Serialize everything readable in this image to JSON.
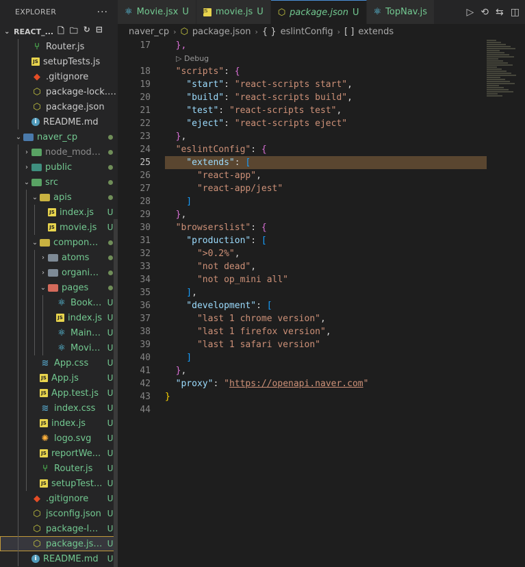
{
  "sidebar": {
    "header": "EXPLORER",
    "more": "···",
    "root": "REACT_...",
    "items": [
      {
        "label": "Router.js",
        "icon": "router-icon",
        "indent": 1,
        "status": "",
        "color": "normal"
      },
      {
        "label": "setupTests.js",
        "icon": "js-icon",
        "indent": 1,
        "status": "",
        "color": "normal"
      },
      {
        "label": ".gitignore",
        "icon": "git-icon",
        "indent": 1,
        "status": "",
        "color": "normal"
      },
      {
        "label": "package-lock.json",
        "icon": "json-icon",
        "indent": 1,
        "status": "",
        "color": "normal"
      },
      {
        "label": "package.json",
        "icon": "json-icon",
        "indent": 1,
        "status": "",
        "color": "normal"
      },
      {
        "label": "README.md",
        "icon": "info-icon",
        "indent": 1,
        "status": "",
        "color": "normal"
      },
      {
        "label": "naver_cp",
        "icon": "folder-blue",
        "indent": 0,
        "twist": "down",
        "status": "dot",
        "color": "mod"
      },
      {
        "label": "node_modules",
        "icon": "folder-green",
        "indent": 1,
        "twist": "right",
        "status": "dot",
        "color": "dim"
      },
      {
        "label": "public",
        "icon": "folder-teal",
        "indent": 1,
        "twist": "right",
        "status": "dot",
        "color": "mod"
      },
      {
        "label": "src",
        "icon": "folder-green",
        "indent": 1,
        "twist": "down",
        "status": "dot",
        "color": "mod"
      },
      {
        "label": "apis",
        "icon": "folder-orange",
        "indent": 2,
        "twist": "down",
        "status": "dot",
        "color": "mod"
      },
      {
        "label": "index.js",
        "icon": "js-icon",
        "indent": 3,
        "status": "U",
        "color": "mod"
      },
      {
        "label": "movie.js",
        "icon": "js-icon",
        "indent": 3,
        "status": "U",
        "color": "mod"
      },
      {
        "label": "compone...",
        "icon": "folder-orange",
        "indent": 2,
        "twist": "down",
        "status": "dot",
        "color": "mod"
      },
      {
        "label": "atoms",
        "icon": "folder-gray",
        "indent": 3,
        "twist": "right",
        "status": "dot",
        "color": "mod"
      },
      {
        "label": "organis...",
        "icon": "folder-gray",
        "indent": 3,
        "twist": "right",
        "status": "dot",
        "color": "mod"
      },
      {
        "label": "pages",
        "icon": "folder-red",
        "indent": 3,
        "twist": "down",
        "status": "dot",
        "color": "mod"
      },
      {
        "label": "Book.jsx",
        "icon": "react-icon",
        "indent": 4,
        "status": "U",
        "color": "mod"
      },
      {
        "label": "index.js",
        "icon": "js-icon",
        "indent": 4,
        "status": "U",
        "color": "mod"
      },
      {
        "label": "Main.jsx",
        "icon": "react-icon",
        "indent": 4,
        "status": "U",
        "color": "mod"
      },
      {
        "label": "Movie.j...",
        "icon": "react-icon",
        "indent": 4,
        "status": "U",
        "color": "mod"
      },
      {
        "label": "App.css",
        "icon": "css-icon",
        "indent": 2,
        "status": "U",
        "color": "mod"
      },
      {
        "label": "App.js",
        "icon": "js-icon",
        "indent": 2,
        "status": "U",
        "color": "mod"
      },
      {
        "label": "App.test.js",
        "icon": "js-icon",
        "indent": 2,
        "status": "U",
        "color": "mod"
      },
      {
        "label": "index.css",
        "icon": "css-icon",
        "indent": 2,
        "status": "U",
        "color": "mod"
      },
      {
        "label": "index.js",
        "icon": "js-icon",
        "indent": 2,
        "status": "U",
        "color": "mod"
      },
      {
        "label": "logo.svg",
        "icon": "svg-icon",
        "indent": 2,
        "status": "U",
        "color": "mod"
      },
      {
        "label": "reportWe...",
        "icon": "js-icon",
        "indent": 2,
        "status": "U",
        "color": "mod"
      },
      {
        "label": "Router.js",
        "icon": "router-icon",
        "indent": 2,
        "status": "U",
        "color": "mod"
      },
      {
        "label": "setupTest...",
        "icon": "js-icon",
        "indent": 2,
        "status": "U",
        "color": "mod"
      },
      {
        "label": ".gitignore",
        "icon": "git-icon",
        "indent": 1,
        "status": "U",
        "color": "mod"
      },
      {
        "label": "jsconfig.json",
        "icon": "json-icon",
        "indent": 1,
        "status": "U",
        "color": "mod"
      },
      {
        "label": "package-lo...",
        "icon": "json-icon",
        "indent": 1,
        "status": "U",
        "color": "mod"
      },
      {
        "label": "package.json",
        "icon": "json-icon",
        "indent": 1,
        "status": "U",
        "color": "mod",
        "selected": true
      },
      {
        "label": "README.md",
        "icon": "info-icon",
        "indent": 1,
        "status": "U",
        "color": "mod"
      }
    ]
  },
  "tabs": [
    {
      "label": "Movie.jsx",
      "badge": "U",
      "icon": "react-icon",
      "active": false
    },
    {
      "label": "movie.js",
      "badge": "U",
      "icon": "js-icon",
      "active": false
    },
    {
      "label": "package.json",
      "badge": "U",
      "icon": "json-icon",
      "active": true
    },
    {
      "label": "TopNav.js",
      "badge": "",
      "icon": "react-icon",
      "active": false
    }
  ],
  "breadcrumb": {
    "folder": "naver_cp",
    "file": "package.json",
    "object": "eslintConfig",
    "array": "extends",
    "object_glyph": "{ }",
    "array_glyph": "[ ]"
  },
  "editor": {
    "current_line": 25,
    "codelens": "Debug",
    "lines": [
      {
        "n": 17,
        "t": [
          [
            "b2",
            "  },"
          ]
        ]
      },
      {
        "n": 18,
        "t": [
          [
            "kkey2",
            "  \"scripts\""
          ],
          [
            "p",
            ": "
          ],
          [
            "b2",
            "{"
          ]
        ]
      },
      {
        "n": 19,
        "t": [
          [
            "kkey",
            "    \"start\""
          ],
          [
            "p",
            ": "
          ],
          [
            "s",
            "\"react-scripts start\""
          ],
          [
            "p",
            ","
          ]
        ]
      },
      {
        "n": 20,
        "t": [
          [
            "kkey",
            "    \"build\""
          ],
          [
            "p",
            ": "
          ],
          [
            "s",
            "\"react-scripts build\""
          ],
          [
            "p",
            ","
          ]
        ]
      },
      {
        "n": 21,
        "t": [
          [
            "kkey",
            "    \"test\""
          ],
          [
            "p",
            ": "
          ],
          [
            "s",
            "\"react-scripts test\""
          ],
          [
            "p",
            ","
          ]
        ]
      },
      {
        "n": 22,
        "t": [
          [
            "kkey",
            "    \"eject\""
          ],
          [
            "p",
            ": "
          ],
          [
            "s",
            "\"react-scripts eject\""
          ]
        ]
      },
      {
        "n": 23,
        "t": [
          [
            "b2",
            "  }"
          ],
          [
            "p",
            ","
          ]
        ]
      },
      {
        "n": 24,
        "t": [
          [
            "kkey2",
            "  \"eslintConfig\""
          ],
          [
            "p",
            ": "
          ],
          [
            "b2",
            "{"
          ]
        ]
      },
      {
        "n": 25,
        "t": [
          [
            "kkey",
            "    \"extends\""
          ],
          [
            "p",
            ": "
          ],
          [
            "b3",
            "["
          ]
        ]
      },
      {
        "n": 26,
        "t": [
          [
            "s",
            "      \"react-app\""
          ],
          [
            "p",
            ","
          ]
        ]
      },
      {
        "n": 27,
        "t": [
          [
            "s",
            "      \"react-app/jest\""
          ]
        ]
      },
      {
        "n": 28,
        "t": [
          [
            "b3",
            "    ]"
          ]
        ]
      },
      {
        "n": 29,
        "t": [
          [
            "b2",
            "  }"
          ],
          [
            "p",
            ","
          ]
        ]
      },
      {
        "n": 30,
        "t": [
          [
            "kkey2",
            "  \"browserslist\""
          ],
          [
            "p",
            ": "
          ],
          [
            "b2",
            "{"
          ]
        ]
      },
      {
        "n": 31,
        "t": [
          [
            "kkey",
            "    \"production\""
          ],
          [
            "p",
            ": "
          ],
          [
            "b3",
            "["
          ]
        ]
      },
      {
        "n": 32,
        "t": [
          [
            "s",
            "      \">0.2%\""
          ],
          [
            "p",
            ","
          ]
        ]
      },
      {
        "n": 33,
        "t": [
          [
            "s",
            "      \"not dead\""
          ],
          [
            "p",
            ","
          ]
        ]
      },
      {
        "n": 34,
        "t": [
          [
            "s",
            "      \"not op_mini all\""
          ]
        ]
      },
      {
        "n": 35,
        "t": [
          [
            "b3",
            "    ]"
          ],
          [
            "p",
            ","
          ]
        ]
      },
      {
        "n": 36,
        "t": [
          [
            "kkey",
            "    \"development\""
          ],
          [
            "p",
            ": "
          ],
          [
            "b3",
            "["
          ]
        ]
      },
      {
        "n": 37,
        "t": [
          [
            "s",
            "      \"last 1 chrome version\""
          ],
          [
            "p",
            ","
          ]
        ]
      },
      {
        "n": 38,
        "t": [
          [
            "s",
            "      \"last 1 firefox version\""
          ],
          [
            "p",
            ","
          ]
        ]
      },
      {
        "n": 39,
        "t": [
          [
            "s",
            "      \"last 1 safari version\""
          ]
        ]
      },
      {
        "n": 40,
        "t": [
          [
            "b3",
            "    ]"
          ]
        ]
      },
      {
        "n": 41,
        "t": [
          [
            "b2",
            "  }"
          ],
          [
            "p",
            ","
          ]
        ]
      },
      {
        "n": 42,
        "t": [
          [
            "kkey",
            "  \"proxy\""
          ],
          [
            "p",
            ": "
          ],
          [
            "s",
            "\""
          ],
          [
            "su",
            "https://openapi.naver.com"
          ],
          [
            "s",
            "\""
          ]
        ]
      },
      {
        "n": 43,
        "t": [
          [
            "b1",
            "}"
          ]
        ]
      },
      {
        "n": 44,
        "t": []
      }
    ]
  }
}
